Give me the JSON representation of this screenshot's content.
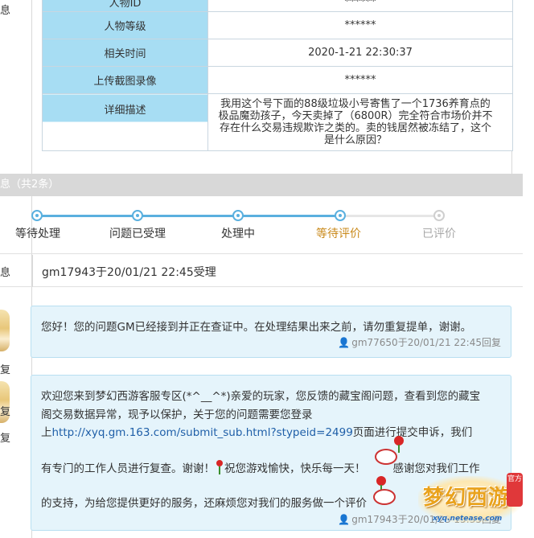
{
  "left_labels": {
    "top1": "息",
    "accept": "息",
    "reply1": "复",
    "reply2a": "复",
    "reply2b": "复"
  },
  "info": {
    "rows": [
      {
        "key": "人物ID",
        "value": "******"
      },
      {
        "key": "人物等级",
        "value": "******"
      },
      {
        "key": "相关时间",
        "value": "2020-1-21 22:30:37"
      },
      {
        "key": "上传截图录像",
        "value": "******"
      },
      {
        "key": "详细描述",
        "value": "我用这个号下面的88级垃圾小号寄售了一个1736养育点的极品魔劲孩子，今天卖掉了（6800R）完全符合市场价并不存在什么交易违规欺诈之类的。卖的钱居然被冻结了，这个是什么原因？"
      }
    ]
  },
  "section": {
    "title": "息（共2条）"
  },
  "progress": {
    "current_index": 3,
    "steps": [
      {
        "label": "等待处理"
      },
      {
        "label": "问题已受理"
      },
      {
        "label": "处理中"
      },
      {
        "label": "等待评价"
      },
      {
        "label": "已评价"
      }
    ],
    "colors": {
      "done": "#5ab0df",
      "current": "#c9891a",
      "todo": "#a8a8a8"
    }
  },
  "accept": {
    "text": "gm17943于20/01/21 22:45受理"
  },
  "replies": [
    {
      "lines": [
        "您好！您的问题GM已经接到并正在查证中。在处理结果出来之前，请勿重复提单，谢谢。"
      ],
      "meta": {
        "user": "gm77650",
        "time": "于20/01/21 22:45",
        "action": "回复"
      }
    },
    {
      "line1": "欢迎您来到梦幻西游客服专区(*^__^*)亲爱的玩家，您反馈的藏宝阁问题，查看到您的藏宝",
      "line2": "阁交易数据异常，现予以保护，关于您的问题需要您登录",
      "line3_prefix": "上",
      "link": "http://xyq.gm.163.com/submit_sub.html?stypeid=2499",
      "line3_suffix": "页面进行提交申诉，我们",
      "line4a": "有专门的工作人员进行复查。谢谢！",
      "line4b": "祝您游戏愉快，快乐每一天！",
      "line4c": "感谢您对我们工作",
      "line5": "的支持，为给您提供更好的服务，还麻烦您对我们的服务做一个评价",
      "meta": {
        "user": "gm17943",
        "time": "于20/01/23 15:35",
        "action": "回复"
      }
    }
  ],
  "logo": {
    "text": "梦幻西游",
    "sub": "xyq.netease.com",
    "tag": "官方"
  },
  "icons": {
    "user": "user-icon",
    "rose": "rose-icon",
    "mascot": "mascot-icon",
    "avatar": "avatar-icon"
  }
}
